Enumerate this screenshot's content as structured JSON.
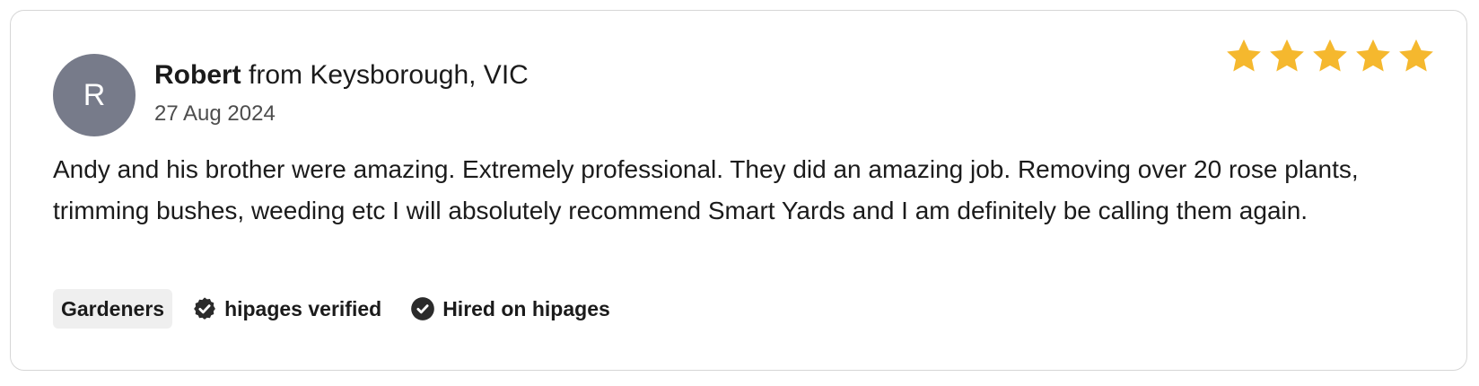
{
  "reviewer": {
    "avatar_initial": "R",
    "name": "Robert",
    "location": " from Keysborough, VIC",
    "date": "27 Aug 2024"
  },
  "rating": {
    "stars": 5,
    "max": 5,
    "color": "#f5b82e"
  },
  "review": {
    "text": "Andy and his brother were amazing. Extremely professional. They did an amazing job. Removing over 20 rose plants, trimming bushes, weeding etc I will absolutely recommend Smart Yards and I am definitely be calling them again."
  },
  "tags": {
    "category": "Gardeners",
    "verified_label": "hipages verified",
    "verified_icon": "verified-badge-icon",
    "hired_label": "Hired on hipages",
    "hired_icon": "check-circle-icon"
  }
}
